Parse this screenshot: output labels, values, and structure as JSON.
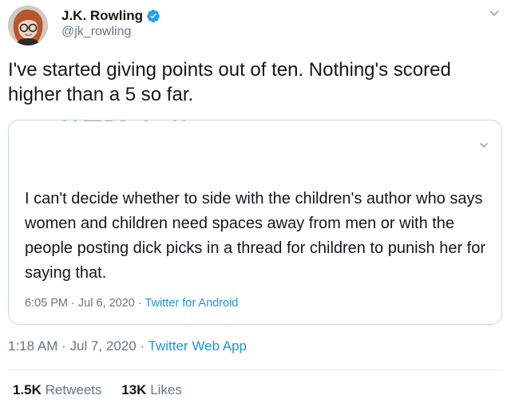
{
  "author": {
    "display_name": "J.K. Rowling",
    "handle": "@jk_rowling",
    "verified_icon": "verified-badge-icon",
    "avatar_icon": "profile-avatar"
  },
  "tweet": {
    "text": "I've started giving points out of ten. Nothing's scored higher than a 5 so far.",
    "time": "1:18 AM",
    "date": "Jul 7, 2020",
    "separator": "·",
    "source": "Twitter Web App"
  },
  "quoted_tweet": {
    "text": "I can't decide whether to side with the children's author who says women and children need spaces away from men or with the people posting dick picks in a thread for children to punish her for saying that.",
    "time": "6:05 PM",
    "date": "Jul 6, 2020",
    "separator": "·",
    "source": "Twitter for Android"
  },
  "stats": {
    "retweets_count": "1.5K",
    "retweets_label": "Retweets",
    "likes_count": "13K",
    "likes_label": "Likes"
  },
  "colors": {
    "text": "#14171a",
    "secondary": "#657786",
    "link": "#1b95e0",
    "verified": "#1da1f2",
    "border": "#ccd6dd"
  }
}
